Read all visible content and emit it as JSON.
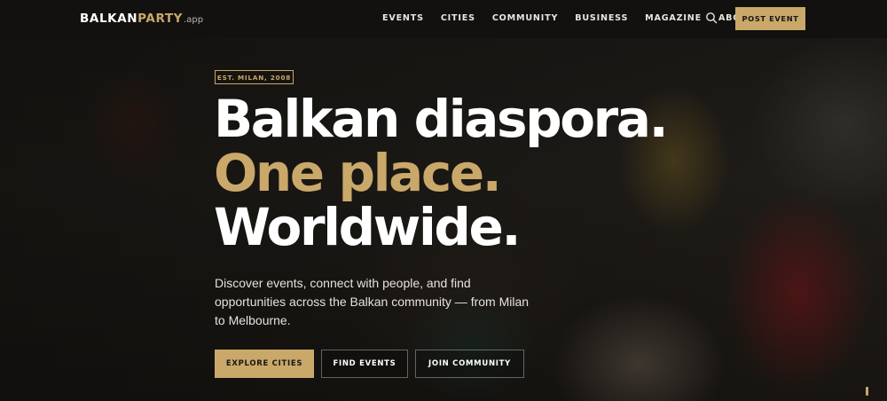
{
  "brand": {
    "part1": "BALKAN",
    "part2": "PARTY",
    "suffix": ".app"
  },
  "nav": {
    "items": [
      "EVENTS",
      "CITIES",
      "COMMUNITY",
      "BUSINESS",
      "MAGAZINE",
      "ABOUT"
    ],
    "search_icon": "search-icon",
    "post_event_label": "POST EVENT"
  },
  "hero": {
    "badge": "EST. MILAN, 2008",
    "headline_line1": "Balkan diaspora.",
    "headline_line2": "One place.",
    "headline_line3": "Worldwide.",
    "lead": "Discover events, connect with people, and find opportunities across the Balkan community — from Milan to Melbourne.",
    "buttons": {
      "explore": "EXPLORE CITIES",
      "events": "FIND EVENTS",
      "join": "JOIN COMMUNITY"
    }
  },
  "colors": {
    "accent": "#c9a86a",
    "topbar": "#121110",
    "text": "#ffffff"
  }
}
